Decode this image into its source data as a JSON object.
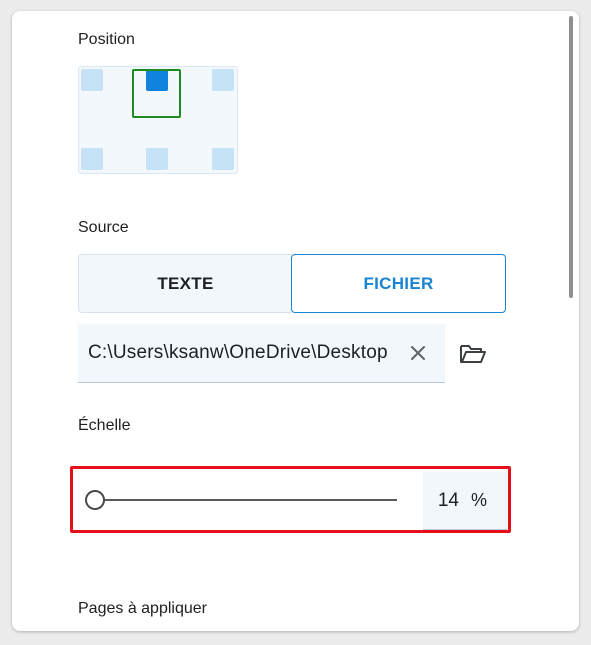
{
  "position": {
    "label": "Position",
    "selected": "top-center"
  },
  "source": {
    "label": "Source",
    "options": [
      "TEXTE",
      "FICHIER"
    ],
    "selected": "FICHIER",
    "file_path": "C:\\Users\\ksanw\\OneDrive\\Desktop"
  },
  "scale": {
    "label": "Échelle",
    "value": "14",
    "unit": "%"
  },
  "pages": {
    "label": "Pages à appliquer"
  },
  "icons": {
    "clear": "close-icon",
    "folder": "folder-open-icon"
  },
  "colors": {
    "accent": "#1a84d4",
    "highlight": "#e3101a",
    "selection": "#1f8a1f"
  }
}
